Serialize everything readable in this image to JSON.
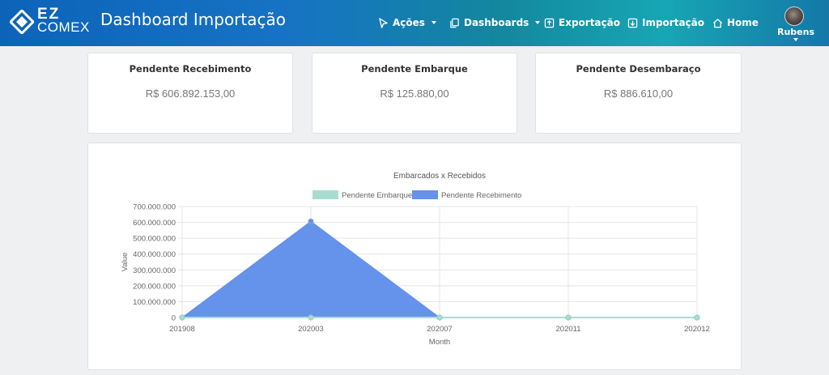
{
  "navbar": {
    "logo_ez": "EZ",
    "logo_comex": "COMEX",
    "title": "Dashboard Importação",
    "items": [
      {
        "label": "Ações",
        "icon": "cursor-icon",
        "dropdown": true
      },
      {
        "label": "Dashboards",
        "icon": "copy-icon",
        "dropdown": true
      },
      {
        "label": "Exportação",
        "icon": "export-box-icon",
        "dropdown": false
      },
      {
        "label": "Importação",
        "icon": "import-box-icon",
        "dropdown": false
      },
      {
        "label": "Home",
        "icon": "home-icon",
        "dropdown": false
      }
    ],
    "user": {
      "name": "Rubens"
    }
  },
  "kpis": [
    {
      "title": "Pendente Recebimento",
      "value": "R$ 606.892.153,00"
    },
    {
      "title": "Pendente Embarque",
      "value": "R$ 125.880,00"
    },
    {
      "title": "Pendente Desembaraço",
      "value": "R$ 886.610,00"
    }
  ],
  "colors": {
    "embarque": "#a7ddd0",
    "recebimento": "#6592ea",
    "gridline": "#e4e4e4"
  },
  "chart_data": {
    "type": "area",
    "title": "Embarcados x Recebidos",
    "xlabel": "Month",
    "ylabel": "Value",
    "categories": [
      "201908",
      "202003",
      "202007",
      "202011",
      "202012"
    ],
    "ylim": [
      0,
      700000000
    ],
    "yticks": [
      0,
      100000000,
      200000000,
      300000000,
      400000000,
      500000000,
      600000000,
      700000000
    ],
    "ytick_labels": [
      "0",
      "100.000.000",
      "200.000.000",
      "300.000.000",
      "400.000.000",
      "500.000.000",
      "600.000.000",
      "700.000.000"
    ],
    "legend_position": "top",
    "grid": true,
    "series": [
      {
        "name": "Pendente Embarque",
        "values": [
          0,
          0,
          0,
          0,
          0
        ]
      },
      {
        "name": "Pendente Recebimento",
        "values": [
          0,
          606892153,
          0,
          0,
          0
        ]
      }
    ]
  }
}
